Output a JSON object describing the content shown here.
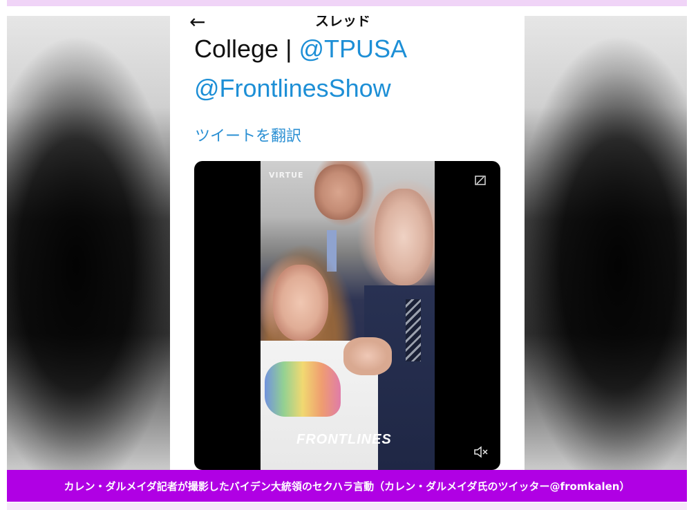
{
  "thread_header": {
    "title": "スレッド",
    "back_icon": "arrow-left-icon"
  },
  "tweet": {
    "text_prefix": "College | ",
    "handle_1": "@TPUSA",
    "handle_2": "@FrontlinesShow",
    "translate_label": "ツイートを翻訳"
  },
  "video": {
    "watermark": "VIRTUE",
    "brand_overlay": "FRONTLINES",
    "pip_icon": "picture-in-picture-icon",
    "mute_icon": "speaker-muted-icon"
  },
  "caption": {
    "text": "カレン・ダルメイダ記者が撮影したバイデン大統領のセクハラ言動（カレン・ダルメイダ氏のツイッター@fromkalen）"
  },
  "colors": {
    "caption_background": "#b000e4",
    "handle_link": "#1d8fd6",
    "translate_link": "#2a8fd3",
    "top_strip": "#f0d4f7"
  }
}
